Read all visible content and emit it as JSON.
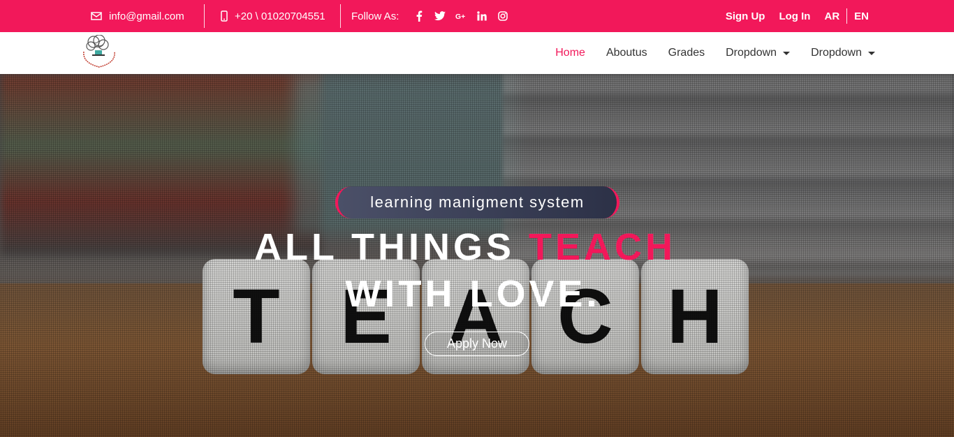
{
  "topbar": {
    "email": "info@gmail.com",
    "phone": "+20 \\ 01020704551",
    "follow_label": "Follow As:",
    "social": [
      "facebook-icon",
      "twitter-icon",
      "google-plus-icon",
      "linkedin-icon",
      "instagram-icon"
    ],
    "signup": "Sign Up",
    "login": "Log In",
    "lang_ar": "AR",
    "lang_en": "EN"
  },
  "nav": {
    "items": [
      {
        "label": "Home",
        "active": true
      },
      {
        "label": "Aboutus"
      },
      {
        "label": "Grades"
      },
      {
        "label": "Dropdown"
      },
      {
        "label": "Dropdown"
      }
    ]
  },
  "hero": {
    "badge": "learning manigment system",
    "headline_part1": "ALL THINGS ",
    "headline_highlight": "TEACH",
    "headline_line2": "WITH LOVE.",
    "cta": "Apply Now",
    "dice_letters": [
      "T",
      "E",
      "A",
      "C",
      "H"
    ]
  },
  "colors": {
    "accent": "#f2185a",
    "nav_text": "#333333",
    "badge_bg": "#2c3147"
  }
}
